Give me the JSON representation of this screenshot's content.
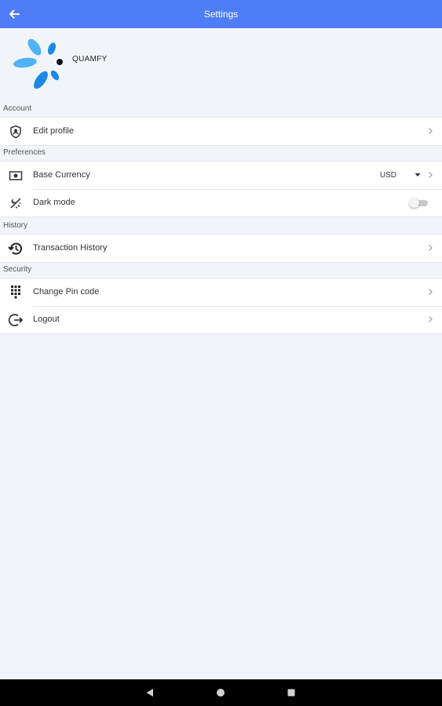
{
  "appbar": {
    "title": "Settings",
    "back_icon": "arrow-left-icon"
  },
  "brand": {
    "name": "QUAMFY",
    "logo_icon": "quamfy-logo"
  },
  "sections": {
    "account": {
      "header": "Account",
      "items": [
        {
          "label": "Edit profile",
          "icon": "profile-shield-icon"
        }
      ]
    },
    "preferences": {
      "header": "Preferences",
      "items": [
        {
          "label": "Base Currency",
          "icon": "currency-note-icon",
          "value": "USD"
        },
        {
          "label": "Dark mode",
          "icon": "dark-mode-icon",
          "toggle": false
        }
      ]
    },
    "history": {
      "header": "History",
      "items": [
        {
          "label": "Transaction History",
          "icon": "history-icon"
        }
      ]
    },
    "security": {
      "header": "Security",
      "items": [
        {
          "label": "Change Pin code",
          "icon": "keypad-icon"
        },
        {
          "label": "Logout",
          "icon": "logout-icon"
        }
      ]
    }
  },
  "colors": {
    "appbar": "#4f7cf7",
    "background": "#f1f5fa",
    "logo_blue": "#1e88e5",
    "logo_light": "#4fb3f5"
  }
}
